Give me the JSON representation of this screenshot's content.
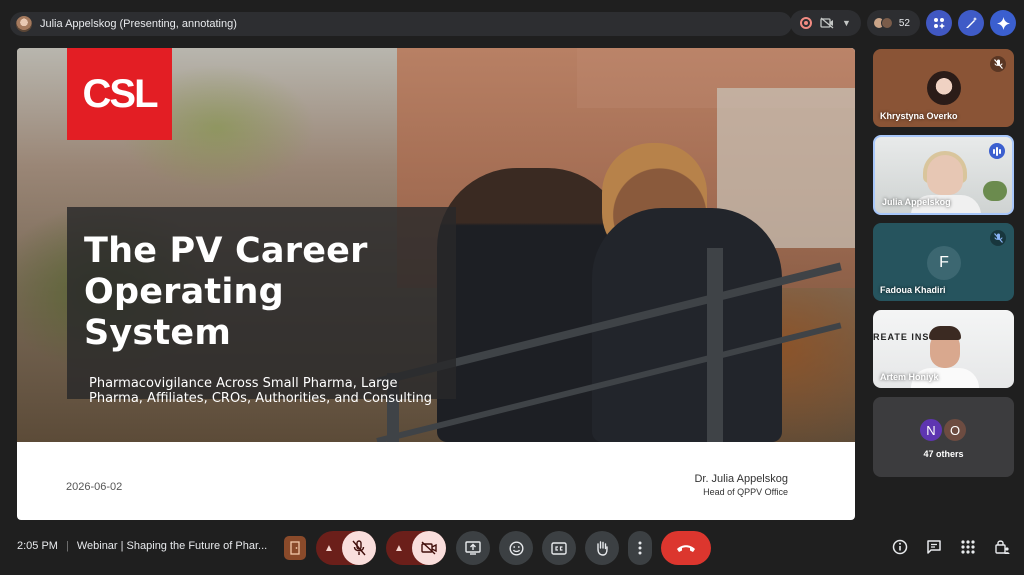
{
  "presenter": {
    "label": "Julia Appelskog (Presenting, annotating)"
  },
  "topbar": {
    "people_count": "52"
  },
  "slide": {
    "logo": "CSL",
    "title": "The PV Career Operating System",
    "subtitle": "Pharmacovigilance Across Small Pharma, Large Pharma, Affiliates, CROs, Authorities, and Consulting",
    "date": "2026-06-02",
    "author_name": "Dr. Julia Appelskog",
    "author_role": "Head of QPPV Office"
  },
  "participants": [
    {
      "name": "Khrystyna Overko",
      "mic": "off"
    },
    {
      "name": "Julia Appelskog",
      "mic": "speaking"
    },
    {
      "name": "Fadoua Khadiri",
      "initial": "F",
      "mic": "off"
    },
    {
      "name": "Artem Honiyk",
      "wall_text": "REATE INS"
    }
  ],
  "others": {
    "initials": [
      "N",
      "O"
    ],
    "label": "47 others"
  },
  "bottom": {
    "time": "2:05 PM",
    "separator": "|",
    "meeting_title": "Webinar | Shaping the Future of Phar..."
  },
  "colors": {
    "end_call": "#dc362e",
    "mic_off_bg": "#f9dedc",
    "accent": "#3b5fcf",
    "logo_red": "#e31e24"
  }
}
